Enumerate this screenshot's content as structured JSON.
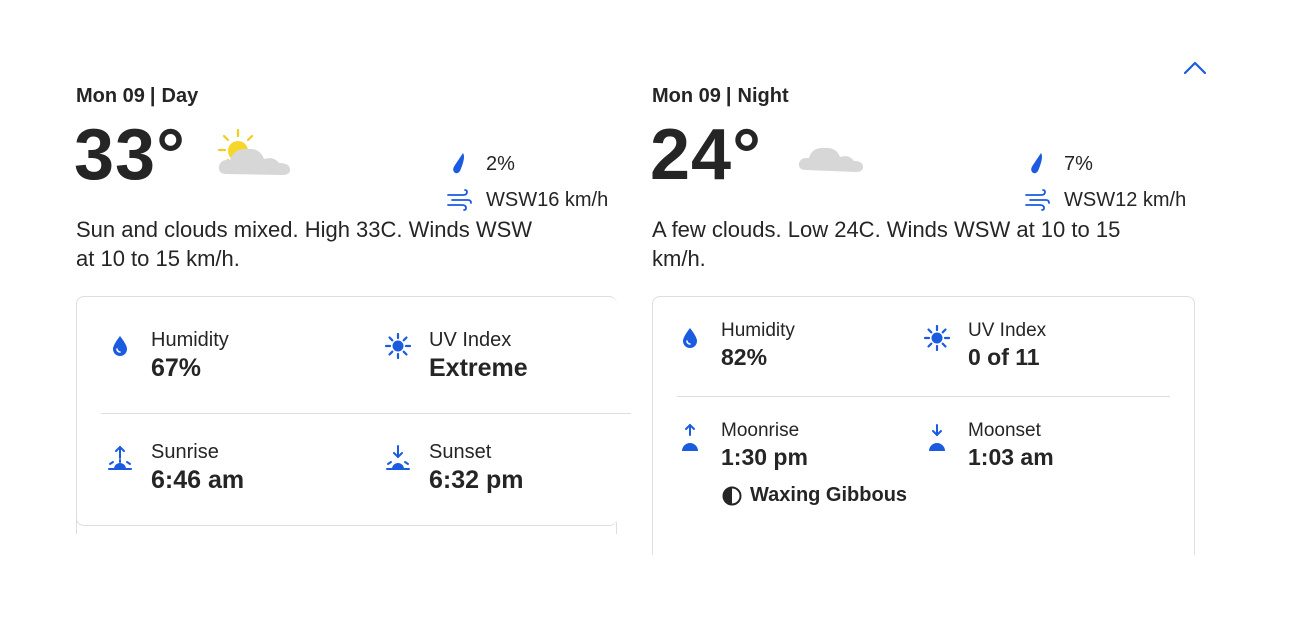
{
  "colors": {
    "accent": "#1a5be0",
    "text": "#252525",
    "border": "#dedede"
  },
  "collapse_icon": "chevron-up-icon",
  "day": {
    "date": "Mon 09",
    "separator": "|",
    "daypart": "Day",
    "temperature": "33°",
    "condition_icon": "partly-sunny-icon",
    "precip_icon": "raindrop-icon",
    "precip": "2%",
    "wind_icon": "wind-icon",
    "wind": "WSW16 km/h",
    "summary": "Sun and clouds mixed. High 33C. Winds WSW at 10 to 15 km/h.",
    "details": {
      "humidity": {
        "label": "Humidity",
        "value": "67%"
      },
      "uv": {
        "label": "UV Index",
        "value": "Extreme"
      },
      "sunrise": {
        "label": "Sunrise",
        "value": "6:46 am"
      },
      "sunset": {
        "label": "Sunset",
        "value": "6:32 pm"
      }
    }
  },
  "night": {
    "date": "Mon 09",
    "separator": "|",
    "daypart": "Night",
    "temperature": "24°",
    "condition_icon": "partly-cloudy-night-icon",
    "precip_icon": "raindrop-icon",
    "precip": "7%",
    "wind_icon": "wind-icon",
    "wind": "WSW12 km/h",
    "summary": "A few clouds. Low 24C. Winds WSW at 10 to 15 km/h.",
    "details": {
      "humidity": {
        "label": "Humidity",
        "value": "82%"
      },
      "uv": {
        "label": "UV Index",
        "value": "0 of 11"
      },
      "moonrise": {
        "label": "Moonrise",
        "value": "1:30 pm"
      },
      "moonset": {
        "label": "Moonset",
        "value": "1:03 am"
      },
      "moon_phase": "Waxing Gibbous"
    }
  }
}
